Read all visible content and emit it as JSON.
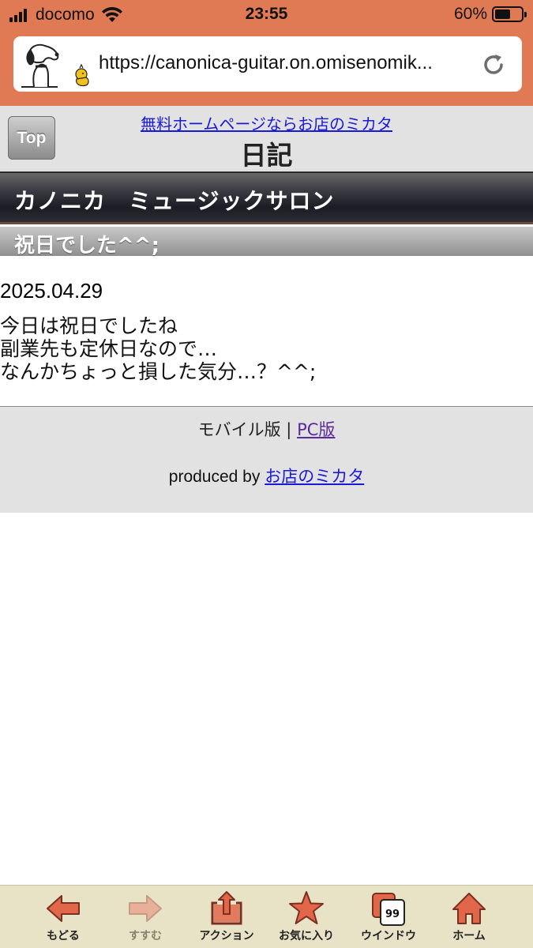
{
  "status_bar": {
    "carrier": "docomo",
    "time": "23:55",
    "battery_percent_text": "60%",
    "battery_level": 0.6
  },
  "browser": {
    "url": "https://canonica-guitar.on.omisenomik...",
    "chrome_color": "#e07a55"
  },
  "header": {
    "top_button": "Top",
    "ad_link": "無料ホームページならお店のミカタ",
    "page_title": "日記"
  },
  "shop": {
    "name": "カノニカ　ミュージックサロン"
  },
  "entry": {
    "title": "祝日でした^^;",
    "date": "2025.04.29",
    "lines": [
      "今日は祝日でしたね",
      "副業先も定休日なので…",
      "なんかちょっと損した気分…？^^;"
    ]
  },
  "footer": {
    "mobile_label": "モバイル版",
    "separator": "|",
    "pc_link": "PC版",
    "produced_by": "produced by",
    "brand_link": "お店のミカタ"
  },
  "toolbar": {
    "accent_color": "#e2664a",
    "items": [
      {
        "label": "もどる",
        "icon": "back-arrow-icon"
      },
      {
        "label": "すすむ",
        "icon": "forward-arrow-icon"
      },
      {
        "label": "アクション",
        "icon": "share-icon"
      },
      {
        "label": "お気に入り",
        "icon": "star-icon"
      },
      {
        "label": "ウインドウ",
        "icon": "windows-icon",
        "badge": "99"
      },
      {
        "label": "ホーム",
        "icon": "home-icon"
      }
    ]
  }
}
